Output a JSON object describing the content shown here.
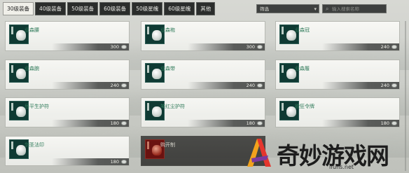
{
  "tabs": [
    {
      "label": "30级装备",
      "active": true
    },
    {
      "label": "40级装备",
      "active": false
    },
    {
      "label": "50级装备",
      "active": false
    },
    {
      "label": "60级装备",
      "active": false
    },
    {
      "label": "50级星魄",
      "active": false
    },
    {
      "label": "60级星魄",
      "active": false
    },
    {
      "label": "其他",
      "active": false
    }
  ],
  "filter": {
    "label": "筛选",
    "icon": "chevron-down-icon"
  },
  "search": {
    "placeholder": "输入搜索名称",
    "icon": "search-icon"
  },
  "items": [
    {
      "name": "业森腰",
      "price": "300"
    },
    {
      "name": "业森袍",
      "price": "300"
    },
    {
      "name": "业森冠",
      "price": "240"
    },
    {
      "name": "业森腕",
      "price": "240"
    },
    {
      "name": "业森带",
      "price": "240"
    },
    {
      "name": "业森履",
      "price": "240"
    },
    {
      "name": "岳平生护符",
      "price": "180"
    },
    {
      "name": "笑红尘护符",
      "price": "180"
    },
    {
      "name": "欲狂令牌",
      "price": "180"
    },
    {
      "name": "剑圣法印",
      "price": "180"
    },
    {
      "name": "购开制",
      "price": "",
      "locked": true
    }
  ],
  "watermark": {
    "text": "奇妙游戏网",
    "url": "lfuns.net"
  },
  "colors": {
    "item_name": "#2e7a59",
    "tab_bg": "#2b2d2c",
    "tab_active_bg": "#f0efe9",
    "icon_bg": "#0f3a33"
  }
}
